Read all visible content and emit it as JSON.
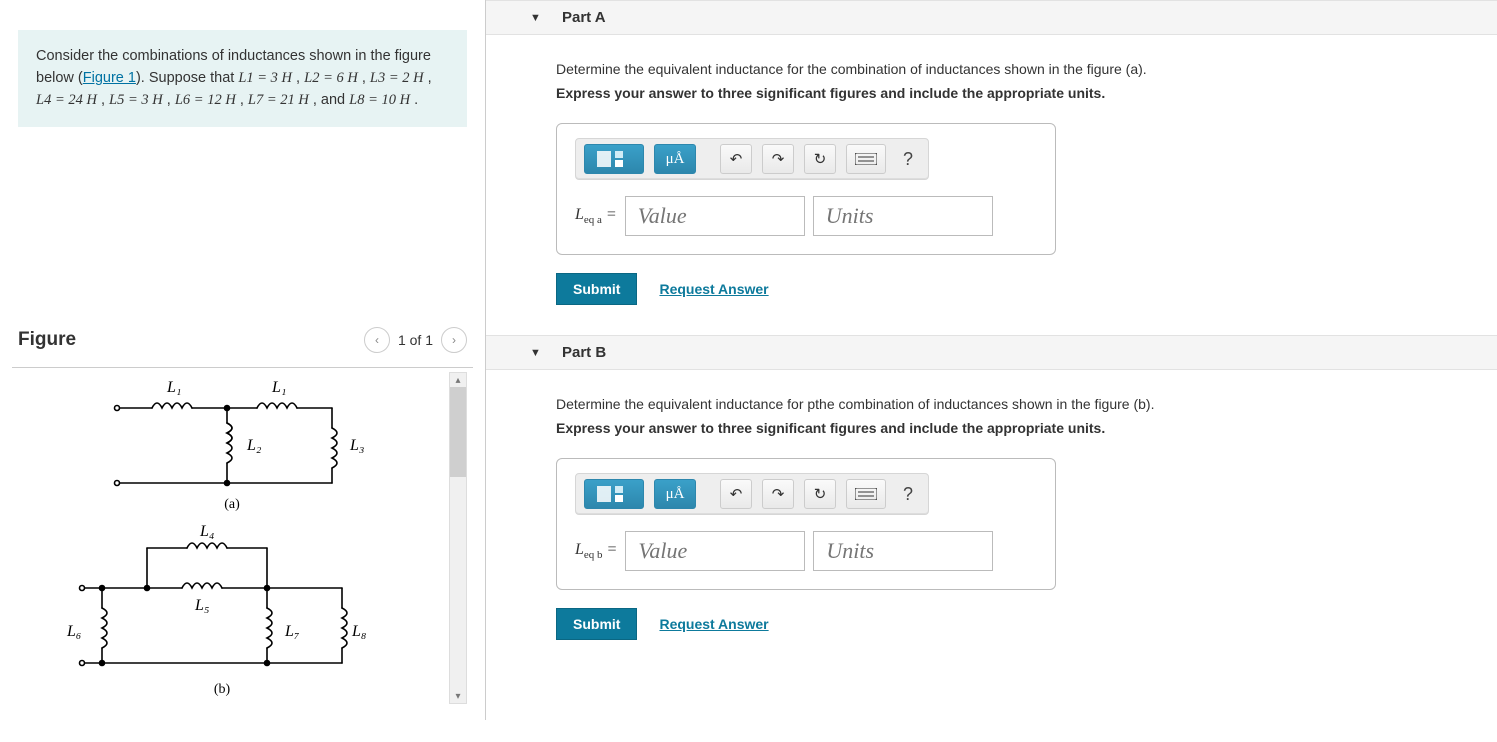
{
  "prompt": {
    "intro_a": "Consider the combinations of inductances shown in the figure below (",
    "figure_link": "Figure 1",
    "intro_b": "). Suppose that ",
    "L1": "L1 = 3 H",
    "L2": "L2 = 6 H",
    "L3": "L3 = 2 H",
    "L4": "L4 = 24 H",
    "L5": "L5 = 3 H",
    "L6": "L6 = 12 H",
    "L7": "L7 = 21 H",
    "L8": "L8 = 10 H"
  },
  "figure": {
    "title": "Figure",
    "nav_count": "1 of 1",
    "labels": {
      "L1a": "L₁",
      "L1b": "L₁",
      "L2": "L₂",
      "L3": "L₃",
      "L4": "L₄",
      "L5": "L₅",
      "L6": "L₆",
      "L7": "L₇",
      "L8": "L₈",
      "a": "(a)",
      "b": "(b)"
    }
  },
  "partA": {
    "title": "Part A",
    "instr": "Determine the equivalent inductance for the combination of inductances shown in the figure (a).",
    "instr2": "Express your answer to three significant figures and include the appropriate units.",
    "label_html": "Leq a =",
    "value_placeholder": "Value",
    "units_placeholder": "Units",
    "submit": "Submit",
    "request": "Request Answer",
    "mu_a": "μÅ",
    "help": "?"
  },
  "partB": {
    "title": "Part B",
    "instr": "Determine the equivalent inductance for pthe combination of inductances shown in the figure (b).",
    "instr2": "Express your answer to three significant figures and include the appropriate units.",
    "label_html": "Leq b =",
    "value_placeholder": "Value",
    "units_placeholder": "Units",
    "submit": "Submit",
    "request": "Request Answer",
    "mu_a": "μÅ",
    "help": "?"
  }
}
